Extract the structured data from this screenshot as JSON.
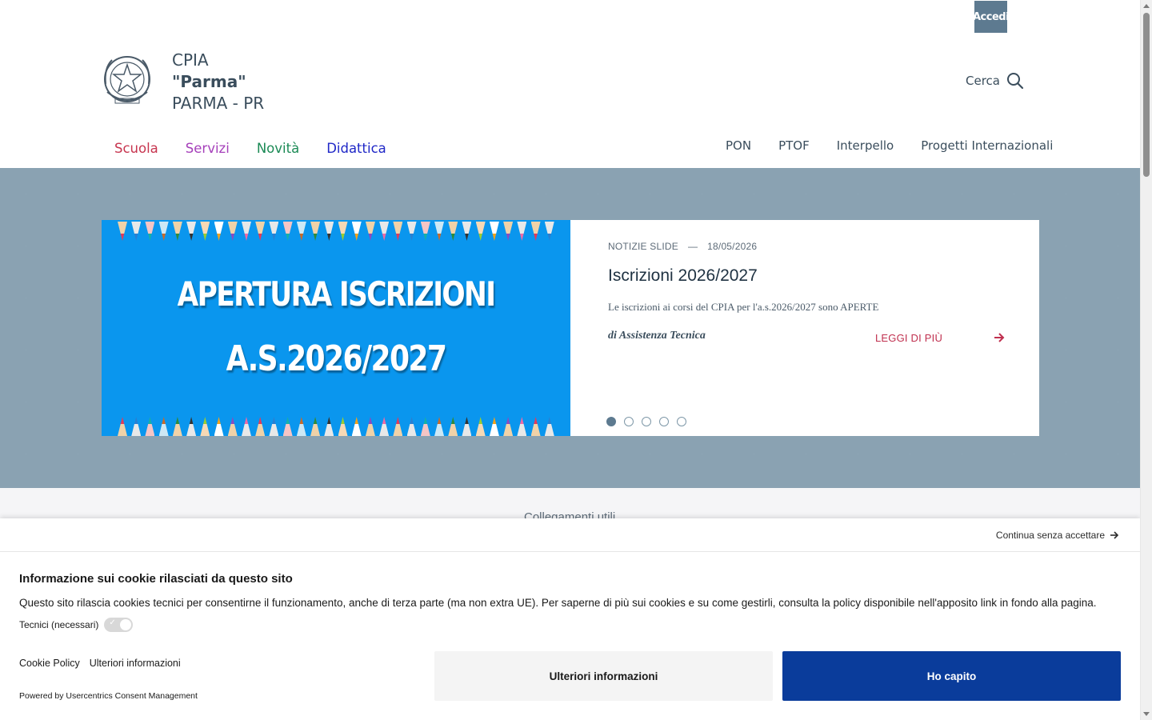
{
  "header": {
    "login_label": "Accedi",
    "school_type": "CPIA",
    "school_name": "\"Parma\"",
    "school_city": "PARMA - PR",
    "search_label": "Cerca"
  },
  "main_nav": [
    {
      "label": "Scuola",
      "color": "#c7354f"
    },
    {
      "label": "Servizi",
      "color": "#a53fba"
    },
    {
      "label": "Novità",
      "color": "#1b8a55"
    },
    {
      "label": "Didattica",
      "color": "#1f27c7"
    }
  ],
  "secondary_nav": [
    {
      "label": "PON"
    },
    {
      "label": "PTOF"
    },
    {
      "label": "Interpello"
    },
    {
      "label": "Progetti Internazionali"
    }
  ],
  "slide": {
    "image_line1": "APERTURA ISCRIZIONI",
    "image_line2": "A.S.2026/2027",
    "category": "NOTIZIE SLIDE",
    "separator": "—",
    "date": "18/05/2026",
    "title": "Iscrizioni 2026/2027",
    "description": "Le iscrizioni ai corsi del CPIA per l'a.s.2026/2027 sono APERTE",
    "author": "di Assistenza Tecnica",
    "read_more": "LEGGI DI PIÙ",
    "dots_total": 5,
    "active_dot": 1
  },
  "useful_links_title": "Collegamenti utili",
  "cookie": {
    "skip_label": "Continua senza accettare",
    "title": "Informazione sui cookie rilasciati da questo sito",
    "text": "Questo sito rilascia cookies tecnici per consentirne il funzionamento, anche di terza parte (ma non extra UE). Per saperne di più sui cookies e su come gestirli, consulta la policy disponibile nell'apposito link in fondo alla pagina.",
    "toggle_label": "Tecnici (necessari)",
    "link_policy": "Cookie Policy",
    "link_more": "Ulteriori informazioni",
    "powered_by": "Powered by Usercentrics Consent Management",
    "btn_more": "Ulteriori informazioni",
    "btn_ok": "Ho capito"
  },
  "colors": {
    "hero_bg": "#6e8a9c",
    "primary_button": "#0a3c9b",
    "accent_link": "#c0304f"
  }
}
